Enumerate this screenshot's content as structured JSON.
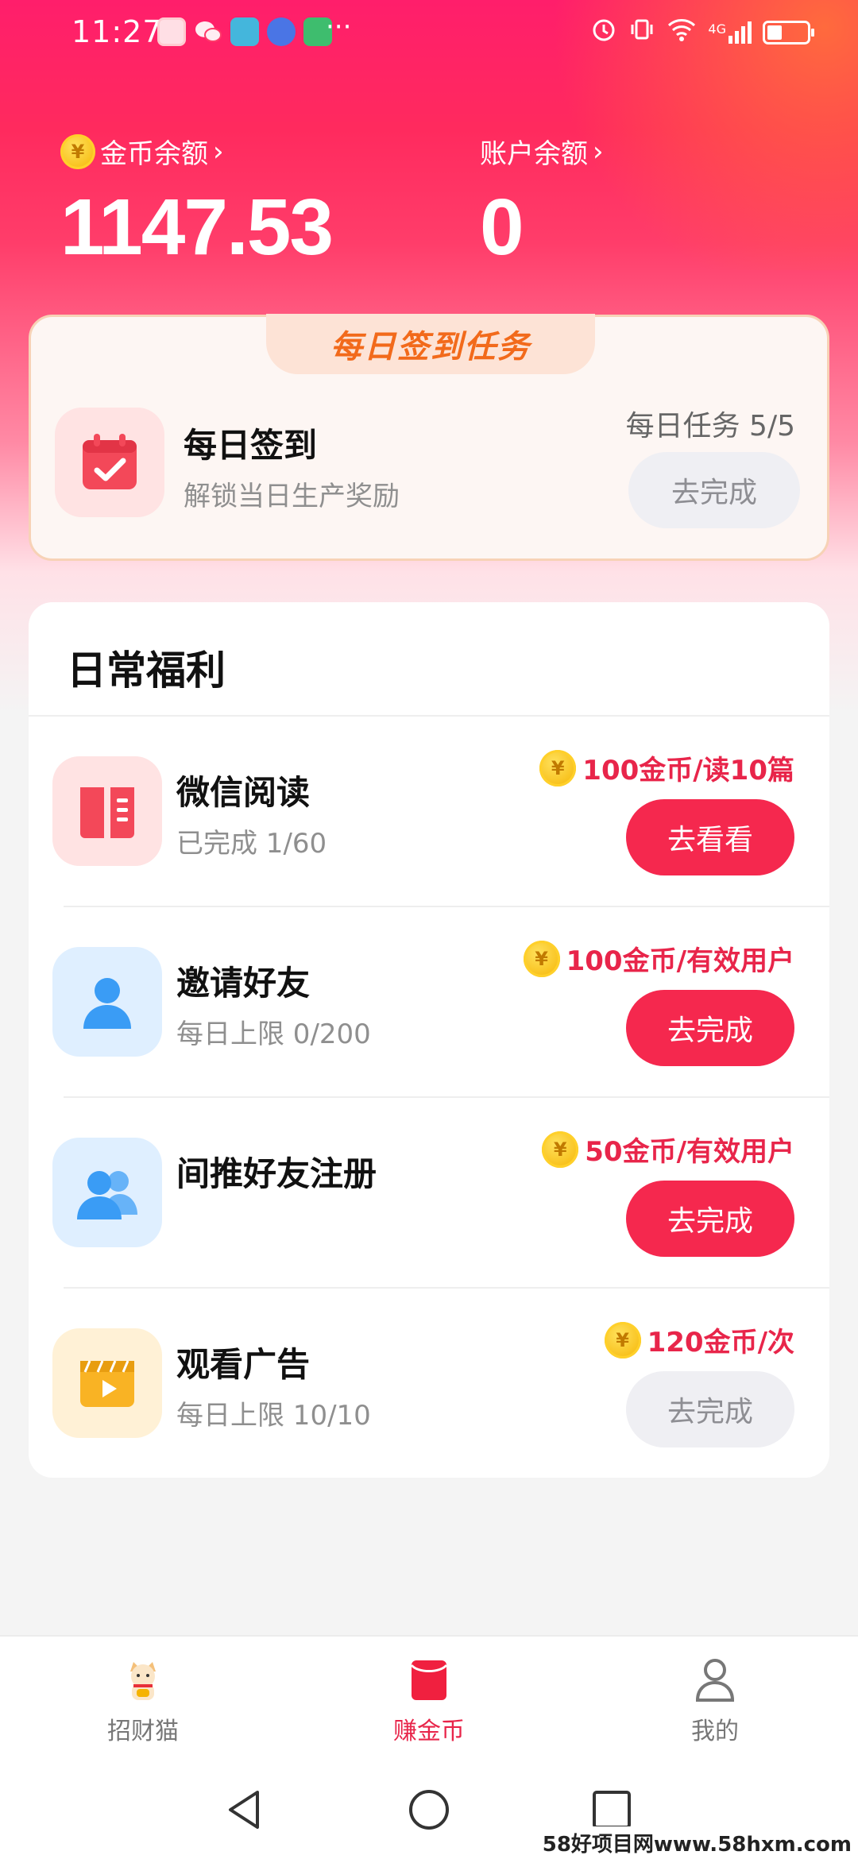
{
  "status_bar": {
    "time": "11:27",
    "more": "···",
    "signal": "4G"
  },
  "balances": {
    "coin_label": "金币余额",
    "coin_value": "1147.53",
    "account_label": "账户余额",
    "account_value": "0"
  },
  "daily_signin": {
    "title": "每日签到任务",
    "item_title": "每日签到",
    "item_subtitle": "解锁当日生产奖励",
    "progress": "每日任务 5/5",
    "button": "去完成"
  },
  "benefits": {
    "title": "日常福利",
    "items": [
      {
        "title": "微信阅读",
        "subtitle": "已完成 1/60",
        "reward": "100金币/读10篇",
        "button": "去看看",
        "button_state": "active",
        "icon": "book-icon"
      },
      {
        "title": "邀请好友",
        "subtitle": "每日上限 0/200",
        "reward": "100金币/有效用户",
        "button": "去完成",
        "button_state": "active",
        "icon": "person-icon"
      },
      {
        "title": "间推好友注册",
        "subtitle": "",
        "reward": "50金币/有效用户",
        "button": "去完成",
        "button_state": "active",
        "icon": "group-icon"
      },
      {
        "title": "观看广告",
        "subtitle": "每日上限 10/10",
        "reward": "120金币/次",
        "button": "去完成",
        "button_state": "disabled",
        "icon": "video-icon"
      }
    ]
  },
  "bottom_nav": {
    "items": [
      {
        "label": "招财猫",
        "icon": "lucky-cat-icon",
        "active": false
      },
      {
        "label": "赚金币",
        "icon": "red-envelope-icon",
        "active": true
      },
      {
        "label": "我的",
        "icon": "user-icon",
        "active": false
      }
    ]
  },
  "watermark": "58好项目网www.58hxm.com",
  "colors": {
    "accent": "#f5284e",
    "reward_text": "#e8254a",
    "sign_title": "#f26a1b"
  }
}
